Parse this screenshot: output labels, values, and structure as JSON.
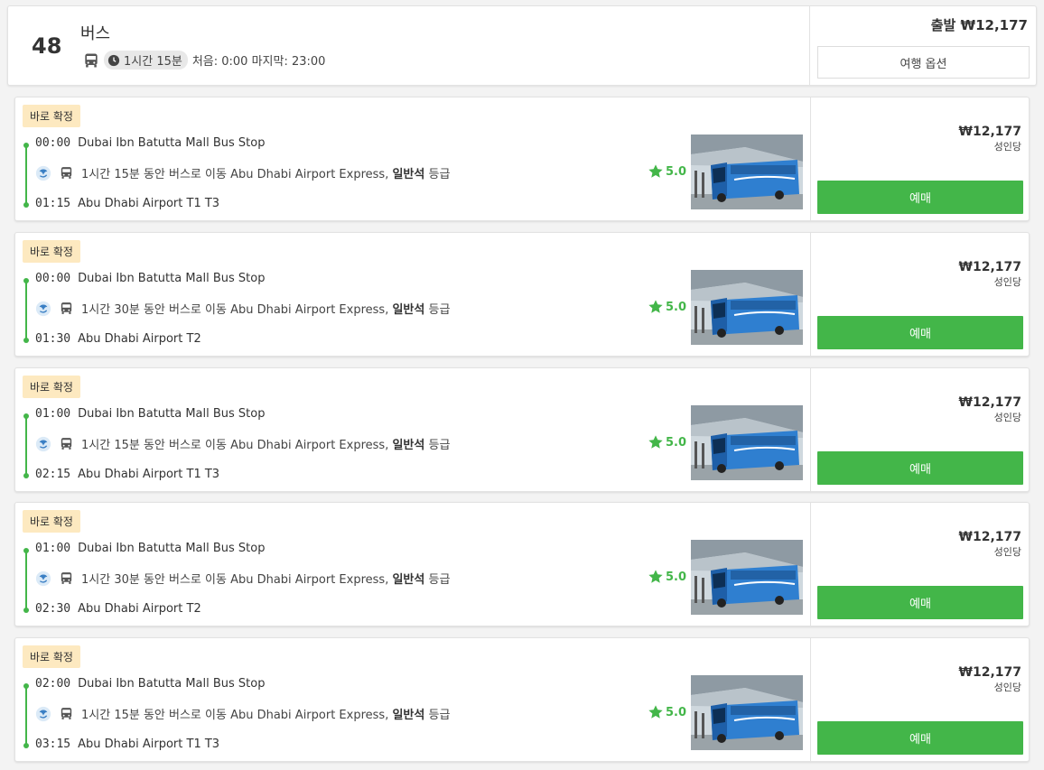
{
  "header": {
    "count": "48",
    "title": "버스",
    "duration": "1시간 15분",
    "first_last": "처음: 0:00 마지막: 23:00",
    "from_price": "출발 ₩12,177",
    "options_label": "여행 옵션"
  },
  "trips": [
    {
      "badge": "바로 확정",
      "depart_time": "00:00",
      "depart_stop": "Dubai Ibn Batutta Mall Bus Stop",
      "leg_text": "1시간 15분 동안 버스로 이동 Abu Dhabi Airport Express,",
      "class_name": "일반석",
      "class_suffix": "등급",
      "arrive_time": "01:15",
      "arrive_stop": "Abu Dhabi Airport T1 T3",
      "rating": "5.0",
      "price": "₩12,177",
      "per": "성인당",
      "book_label": "예매"
    },
    {
      "badge": "바로 확정",
      "depart_time": "00:00",
      "depart_stop": "Dubai Ibn Batutta Mall Bus Stop",
      "leg_text": "1시간 30분 동안 버스로 이동 Abu Dhabi Airport Express,",
      "class_name": "일반석",
      "class_suffix": "등급",
      "arrive_time": "01:30",
      "arrive_stop": "Abu Dhabi Airport T2",
      "rating": "5.0",
      "price": "₩12,177",
      "per": "성인당",
      "book_label": "예매"
    },
    {
      "badge": "바로 확정",
      "depart_time": "01:00",
      "depart_stop": "Dubai Ibn Batutta Mall Bus Stop",
      "leg_text": "1시간 15분 동안 버스로 이동 Abu Dhabi Airport Express,",
      "class_name": "일반석",
      "class_suffix": "등급",
      "arrive_time": "02:15",
      "arrive_stop": "Abu Dhabi Airport T1 T3",
      "rating": "5.0",
      "price": "₩12,177",
      "per": "성인당",
      "book_label": "예매"
    },
    {
      "badge": "바로 확정",
      "depart_time": "01:00",
      "depart_stop": "Dubai Ibn Batutta Mall Bus Stop",
      "leg_text": "1시간 30분 동안 버스로 이동 Abu Dhabi Airport Express,",
      "class_name": "일반석",
      "class_suffix": "등급",
      "arrive_time": "02:30",
      "arrive_stop": "Abu Dhabi Airport T2",
      "rating": "5.0",
      "price": "₩12,177",
      "per": "성인당",
      "book_label": "예매"
    },
    {
      "badge": "바로 확정",
      "depart_time": "02:00",
      "depart_stop": "Dubai Ibn Batutta Mall Bus Stop",
      "leg_text": "1시간 15분 동안 버스로 이동 Abu Dhabi Airport Express,",
      "class_name": "일반석",
      "class_suffix": "등급",
      "arrive_time": "03:15",
      "arrive_stop": "Abu Dhabi Airport T1 T3",
      "rating": "5.0",
      "price": "₩12,177",
      "per": "성인당",
      "book_label": "예매"
    }
  ],
  "icons": {
    "bus": "bus-icon",
    "clock": "clock-icon",
    "operator": "operator-logo-icon",
    "star": "star-icon"
  },
  "colors": {
    "accent_green": "#43b649",
    "badge_bg": "#fde9c0",
    "bus_blue": "#2f7fd0"
  }
}
